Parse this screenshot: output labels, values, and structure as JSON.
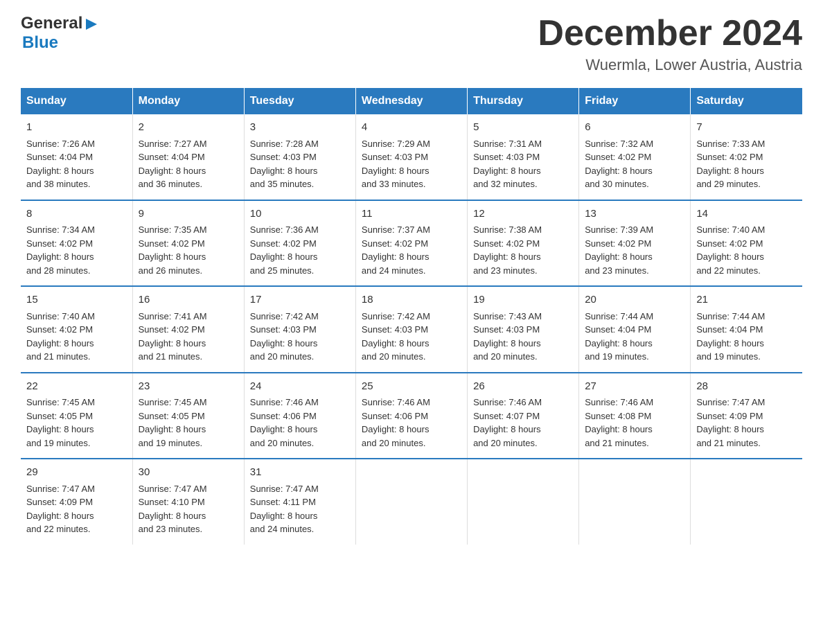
{
  "header": {
    "logo": {
      "line1": "General",
      "triangle": "▶",
      "line2": "Blue"
    },
    "title": "December 2024",
    "subtitle": "Wuermla, Lower Austria, Austria"
  },
  "days_of_week": [
    "Sunday",
    "Monday",
    "Tuesday",
    "Wednesday",
    "Thursday",
    "Friday",
    "Saturday"
  ],
  "weeks": [
    [
      {
        "day": "1",
        "info": "Sunrise: 7:26 AM\nSunset: 4:04 PM\nDaylight: 8 hours\nand 38 minutes."
      },
      {
        "day": "2",
        "info": "Sunrise: 7:27 AM\nSunset: 4:04 PM\nDaylight: 8 hours\nand 36 minutes."
      },
      {
        "day": "3",
        "info": "Sunrise: 7:28 AM\nSunset: 4:03 PM\nDaylight: 8 hours\nand 35 minutes."
      },
      {
        "day": "4",
        "info": "Sunrise: 7:29 AM\nSunset: 4:03 PM\nDaylight: 8 hours\nand 33 minutes."
      },
      {
        "day": "5",
        "info": "Sunrise: 7:31 AM\nSunset: 4:03 PM\nDaylight: 8 hours\nand 32 minutes."
      },
      {
        "day": "6",
        "info": "Sunrise: 7:32 AM\nSunset: 4:02 PM\nDaylight: 8 hours\nand 30 minutes."
      },
      {
        "day": "7",
        "info": "Sunrise: 7:33 AM\nSunset: 4:02 PM\nDaylight: 8 hours\nand 29 minutes."
      }
    ],
    [
      {
        "day": "8",
        "info": "Sunrise: 7:34 AM\nSunset: 4:02 PM\nDaylight: 8 hours\nand 28 minutes."
      },
      {
        "day": "9",
        "info": "Sunrise: 7:35 AM\nSunset: 4:02 PM\nDaylight: 8 hours\nand 26 minutes."
      },
      {
        "day": "10",
        "info": "Sunrise: 7:36 AM\nSunset: 4:02 PM\nDaylight: 8 hours\nand 25 minutes."
      },
      {
        "day": "11",
        "info": "Sunrise: 7:37 AM\nSunset: 4:02 PM\nDaylight: 8 hours\nand 24 minutes."
      },
      {
        "day": "12",
        "info": "Sunrise: 7:38 AM\nSunset: 4:02 PM\nDaylight: 8 hours\nand 23 minutes."
      },
      {
        "day": "13",
        "info": "Sunrise: 7:39 AM\nSunset: 4:02 PM\nDaylight: 8 hours\nand 23 minutes."
      },
      {
        "day": "14",
        "info": "Sunrise: 7:40 AM\nSunset: 4:02 PM\nDaylight: 8 hours\nand 22 minutes."
      }
    ],
    [
      {
        "day": "15",
        "info": "Sunrise: 7:40 AM\nSunset: 4:02 PM\nDaylight: 8 hours\nand 21 minutes."
      },
      {
        "day": "16",
        "info": "Sunrise: 7:41 AM\nSunset: 4:02 PM\nDaylight: 8 hours\nand 21 minutes."
      },
      {
        "day": "17",
        "info": "Sunrise: 7:42 AM\nSunset: 4:03 PM\nDaylight: 8 hours\nand 20 minutes."
      },
      {
        "day": "18",
        "info": "Sunrise: 7:42 AM\nSunset: 4:03 PM\nDaylight: 8 hours\nand 20 minutes."
      },
      {
        "day": "19",
        "info": "Sunrise: 7:43 AM\nSunset: 4:03 PM\nDaylight: 8 hours\nand 20 minutes."
      },
      {
        "day": "20",
        "info": "Sunrise: 7:44 AM\nSunset: 4:04 PM\nDaylight: 8 hours\nand 19 minutes."
      },
      {
        "day": "21",
        "info": "Sunrise: 7:44 AM\nSunset: 4:04 PM\nDaylight: 8 hours\nand 19 minutes."
      }
    ],
    [
      {
        "day": "22",
        "info": "Sunrise: 7:45 AM\nSunset: 4:05 PM\nDaylight: 8 hours\nand 19 minutes."
      },
      {
        "day": "23",
        "info": "Sunrise: 7:45 AM\nSunset: 4:05 PM\nDaylight: 8 hours\nand 19 minutes."
      },
      {
        "day": "24",
        "info": "Sunrise: 7:46 AM\nSunset: 4:06 PM\nDaylight: 8 hours\nand 20 minutes."
      },
      {
        "day": "25",
        "info": "Sunrise: 7:46 AM\nSunset: 4:06 PM\nDaylight: 8 hours\nand 20 minutes."
      },
      {
        "day": "26",
        "info": "Sunrise: 7:46 AM\nSunset: 4:07 PM\nDaylight: 8 hours\nand 20 minutes."
      },
      {
        "day": "27",
        "info": "Sunrise: 7:46 AM\nSunset: 4:08 PM\nDaylight: 8 hours\nand 21 minutes."
      },
      {
        "day": "28",
        "info": "Sunrise: 7:47 AM\nSunset: 4:09 PM\nDaylight: 8 hours\nand 21 minutes."
      }
    ],
    [
      {
        "day": "29",
        "info": "Sunrise: 7:47 AM\nSunset: 4:09 PM\nDaylight: 8 hours\nand 22 minutes."
      },
      {
        "day": "30",
        "info": "Sunrise: 7:47 AM\nSunset: 4:10 PM\nDaylight: 8 hours\nand 23 minutes."
      },
      {
        "day": "31",
        "info": "Sunrise: 7:47 AM\nSunset: 4:11 PM\nDaylight: 8 hours\nand 24 minutes."
      },
      {
        "day": "",
        "info": ""
      },
      {
        "day": "",
        "info": ""
      },
      {
        "day": "",
        "info": ""
      },
      {
        "day": "",
        "info": ""
      }
    ]
  ]
}
